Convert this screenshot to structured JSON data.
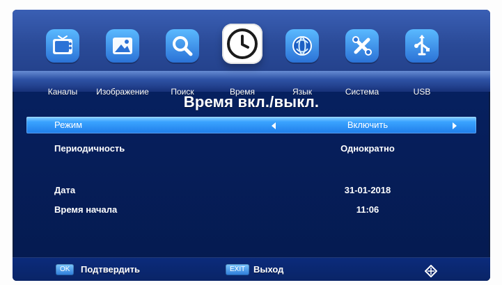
{
  "menu": {
    "tabs": [
      {
        "label": "Каналы",
        "icon": "tv-icon",
        "selected": false
      },
      {
        "label": "Изображение",
        "icon": "image-icon",
        "selected": false
      },
      {
        "label": "Поиск",
        "icon": "search-icon",
        "selected": false
      },
      {
        "label": "Время",
        "icon": "clock-icon",
        "selected": true
      },
      {
        "label": "Язык",
        "icon": "globe-icon",
        "selected": false
      },
      {
        "label": "Система",
        "icon": "tools-icon",
        "selected": false
      },
      {
        "label": "USB",
        "icon": "usb-icon",
        "selected": false
      }
    ]
  },
  "screen": {
    "title": "Время вкл./выкл."
  },
  "settings": {
    "rows": [
      {
        "key": "Режим",
        "value": "Включить",
        "selected": true
      },
      {
        "key": "Периодичность",
        "value": "Однократно",
        "selected": false
      },
      {
        "key": "Дата",
        "value": "31-01-2018",
        "selected": false
      },
      {
        "key": "Время начала",
        "value": "11:06",
        "selected": false
      }
    ]
  },
  "footer": {
    "ok_key": "OK",
    "ok_label": "Подтвердить",
    "exit_key": "EXIT",
    "exit_label": "Выход",
    "nav_icon": "navigation-diamond-icon"
  },
  "colors": {
    "accent": "#2c7ad8",
    "selected_row": "#1f7de9",
    "background": "#06205f"
  }
}
